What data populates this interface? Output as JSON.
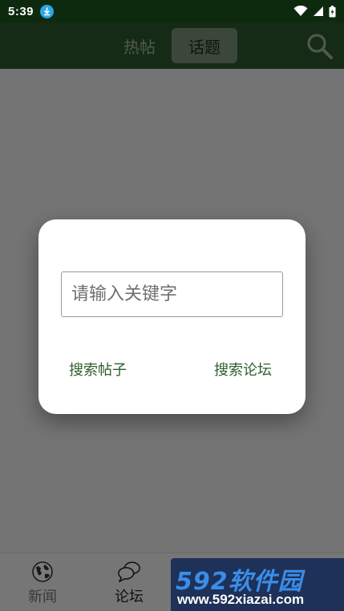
{
  "status_bar": {
    "time": "5:39",
    "icons": [
      "download-icon",
      "wifi-icon",
      "signal-icon",
      "battery-icon"
    ]
  },
  "toolbar": {
    "tabs": [
      {
        "label": "热帖",
        "active": false
      },
      {
        "label": "话题",
        "active": true
      }
    ],
    "search_icon": "search-icon"
  },
  "dialog": {
    "input_placeholder": "请输入关键字",
    "input_value": "",
    "search_posts_label": "搜索帖子",
    "search_forum_label": "搜索论坛"
  },
  "bottom_nav": {
    "items": [
      {
        "label": "新闻",
        "icon": "globe-icon",
        "active": false
      },
      {
        "label": "论坛",
        "icon": "chat-bubbles-icon",
        "active": true
      }
    ]
  },
  "watermark": {
    "title": "592软件园",
    "url": "www.592xiazai.com"
  },
  "colors": {
    "status_bar": "#0e2a0e",
    "toolbar": "#2c5a2c",
    "accent_text": "#2d5e2d",
    "overlay": "rgba(0,0,0,0.52)"
  }
}
